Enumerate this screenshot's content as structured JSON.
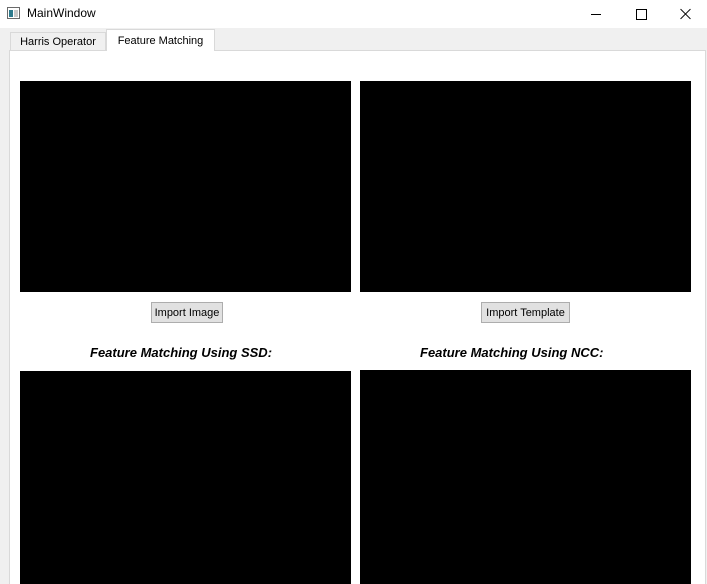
{
  "window": {
    "title": "MainWindow"
  },
  "tabs": [
    {
      "label": "Harris Operator",
      "active": false
    },
    {
      "label": "Feature Matching",
      "active": true
    }
  ],
  "feature_matching": {
    "import_image_label": "Import Image",
    "import_template_label": "Import Template",
    "ssd_label": "Feature Matching Using SSD:",
    "ncc_label": "Feature Matching Using NCC:"
  },
  "icons": {
    "app": "app-icon",
    "minimize": "minimize-icon",
    "maximize": "maximize-icon",
    "close": "close-icon"
  },
  "colors": {
    "panel_background": "#000000",
    "window_background": "#f0f0f0",
    "tab_pane_background": "#ffffff"
  }
}
